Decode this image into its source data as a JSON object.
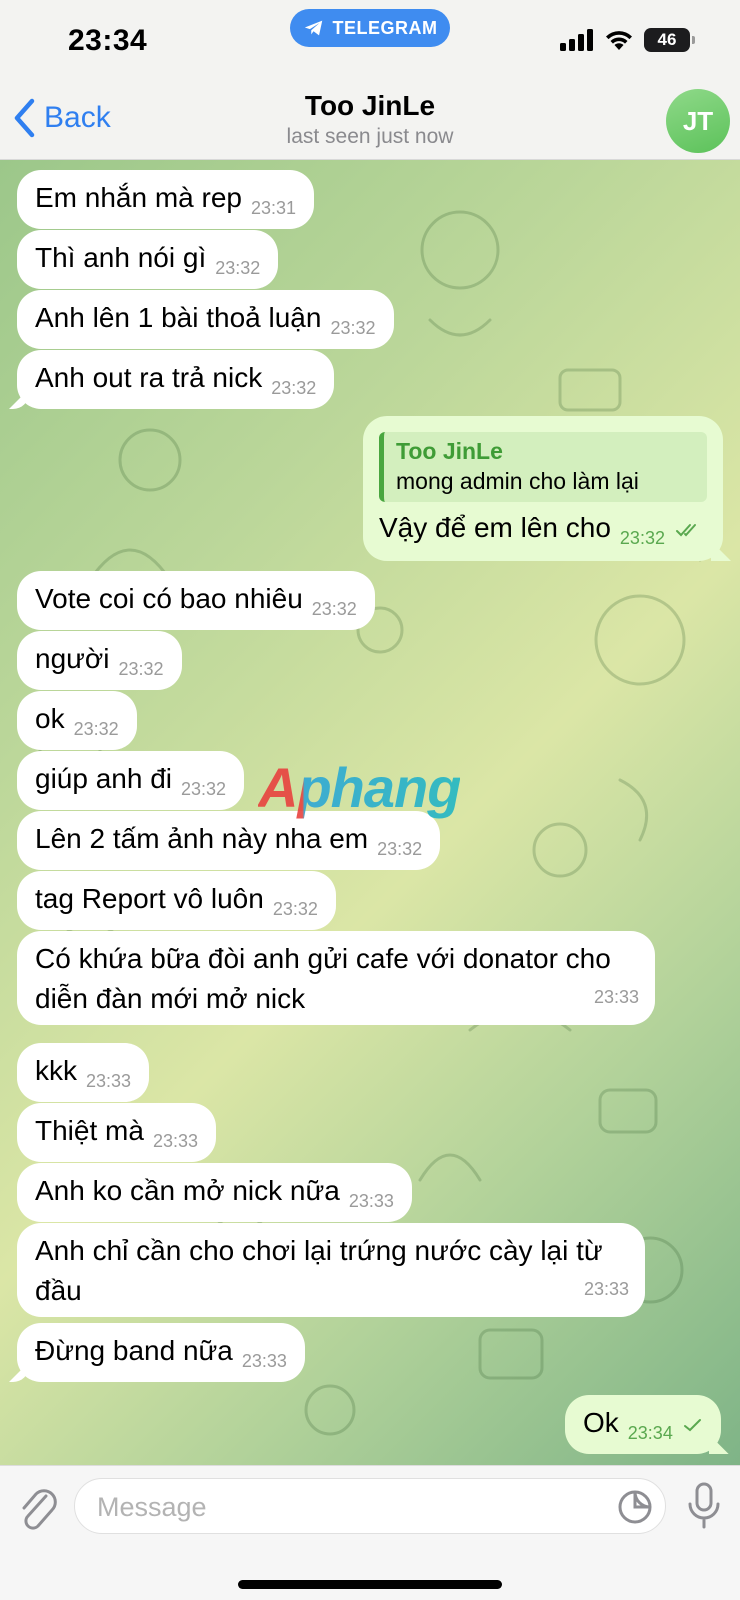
{
  "status_bar": {
    "time": "23:34",
    "app_pill": "TELEGRAM",
    "battery": "46"
  },
  "header": {
    "back_label": "Back",
    "contact_name": "Too JinLe",
    "last_seen": "last seen just now",
    "avatar_initials": "JT"
  },
  "watermark": "Aphang",
  "messages": [
    {
      "text": "Em nhắn mà rep",
      "time": "23:31"
    },
    {
      "text": "Thì anh nói gì",
      "time": "23:32"
    },
    {
      "text": "Anh lên 1 bài thoả luận",
      "time": "23:32"
    },
    {
      "text": "Anh out ra trả nick",
      "time": "23:32"
    },
    {
      "reply_name": "Too JinLe",
      "reply_text": "mong admin cho làm lại",
      "text": "Vậy để em lên cho",
      "time": "23:32"
    },
    {
      "text": "Vote coi có bao nhiêu",
      "time": "23:32"
    },
    {
      "text": "người",
      "time": "23:32"
    },
    {
      "text": "ok",
      "time": "23:32"
    },
    {
      "text": "giúp anh đi",
      "time": "23:32"
    },
    {
      "text": "Lên 2 tấm ảnh này nha em",
      "time": "23:32"
    },
    {
      "text": "tag Report vô luôn",
      "time": "23:32"
    },
    {
      "text": "Có khứa bữa đòi anh gửi cafe với donator cho diễn đàn mới mở nick",
      "time": "23:33"
    },
    {
      "text": "kkk",
      "time": "23:33"
    },
    {
      "text": "Thiệt mà",
      "time": "23:33"
    },
    {
      "text": "Anh ko cần mở nick nữa",
      "time": "23:33"
    },
    {
      "text": "Anh chỉ cần cho chơi lại trứng nước cày lại từ đầu",
      "time": "23:33"
    },
    {
      "text": "Đừng band nữa",
      "time": "23:33"
    },
    {
      "text": "Ok",
      "time": "23:34"
    }
  ],
  "composer": {
    "placeholder": "Message"
  },
  "colors": {
    "accent": "#2f7ff0",
    "outgoing_bubble": "#e7fbd2",
    "incoming_bubble": "#ffffff",
    "avatar": "#6ccd63"
  }
}
